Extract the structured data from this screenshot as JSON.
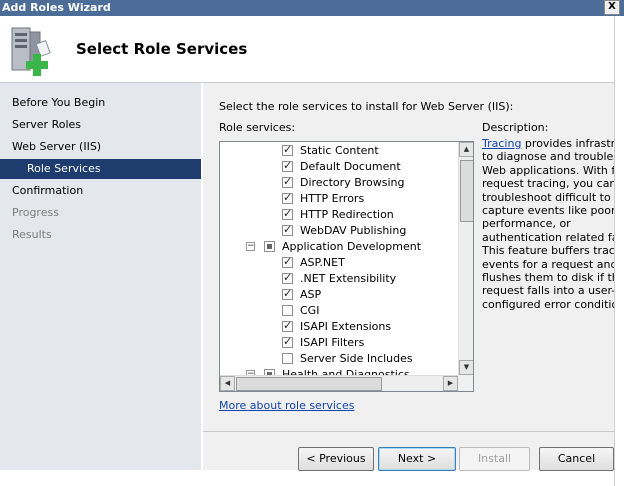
{
  "window": {
    "title": "Add Roles Wizard",
    "close_glyph": "X"
  },
  "header": {
    "title": "Select Role Services",
    "icon": "server-add-icon"
  },
  "nav": {
    "items": [
      {
        "label": "Before You Begin",
        "state": "normal"
      },
      {
        "label": "Server Roles",
        "state": "normal"
      },
      {
        "label": "Web Server (IIS)",
        "state": "normal"
      },
      {
        "label": "Role Services",
        "state": "active"
      },
      {
        "label": "Confirmation",
        "state": "normal"
      },
      {
        "label": "Progress",
        "state": "disabled"
      },
      {
        "label": "Results",
        "state": "disabled"
      }
    ]
  },
  "main": {
    "instruction": "Select the role services to install for Web Server (IIS):",
    "role_services_label": "Role services:",
    "description_label": "Description:",
    "tree": [
      {
        "label": "Static Content",
        "checked": true
      },
      {
        "label": "Default Document",
        "checked": true
      },
      {
        "label": "Directory Browsing",
        "checked": true
      },
      {
        "label": "HTTP Errors",
        "checked": true
      },
      {
        "label": "HTTP Redirection",
        "checked": true
      },
      {
        "label": "WebDAV Publishing",
        "checked": true
      },
      {
        "label": "Application Development",
        "checked": "mixed",
        "group": true,
        "expanded": true
      },
      {
        "label": "ASP.NET",
        "checked": true
      },
      {
        "label": ".NET Extensibility",
        "checked": true
      },
      {
        "label": "ASP",
        "checked": true
      },
      {
        "label": "CGI",
        "checked": false
      },
      {
        "label": "ISAPI Extensions",
        "checked": true
      },
      {
        "label": "ISAPI Filters",
        "checked": true
      },
      {
        "label": "Server Side Includes",
        "checked": false
      },
      {
        "label": "Health and Diagnostics",
        "checked": "mixed",
        "group": true,
        "expanded": true
      }
    ],
    "description": {
      "link": "Tracing",
      "text": " provides infrastructure to diagnose and troubleshoot Web applications. With failed request tracing, you can troubleshoot difficult to capture events like poor performance, or authentication related failures. This feature buffers trace events for a request and only flushes them to disk if the request falls into a user-configured error condition."
    },
    "more_link": "More about role services"
  },
  "footer": {
    "previous": "< Previous",
    "next": "Next >",
    "install": "Install",
    "cancel": "Cancel"
  }
}
